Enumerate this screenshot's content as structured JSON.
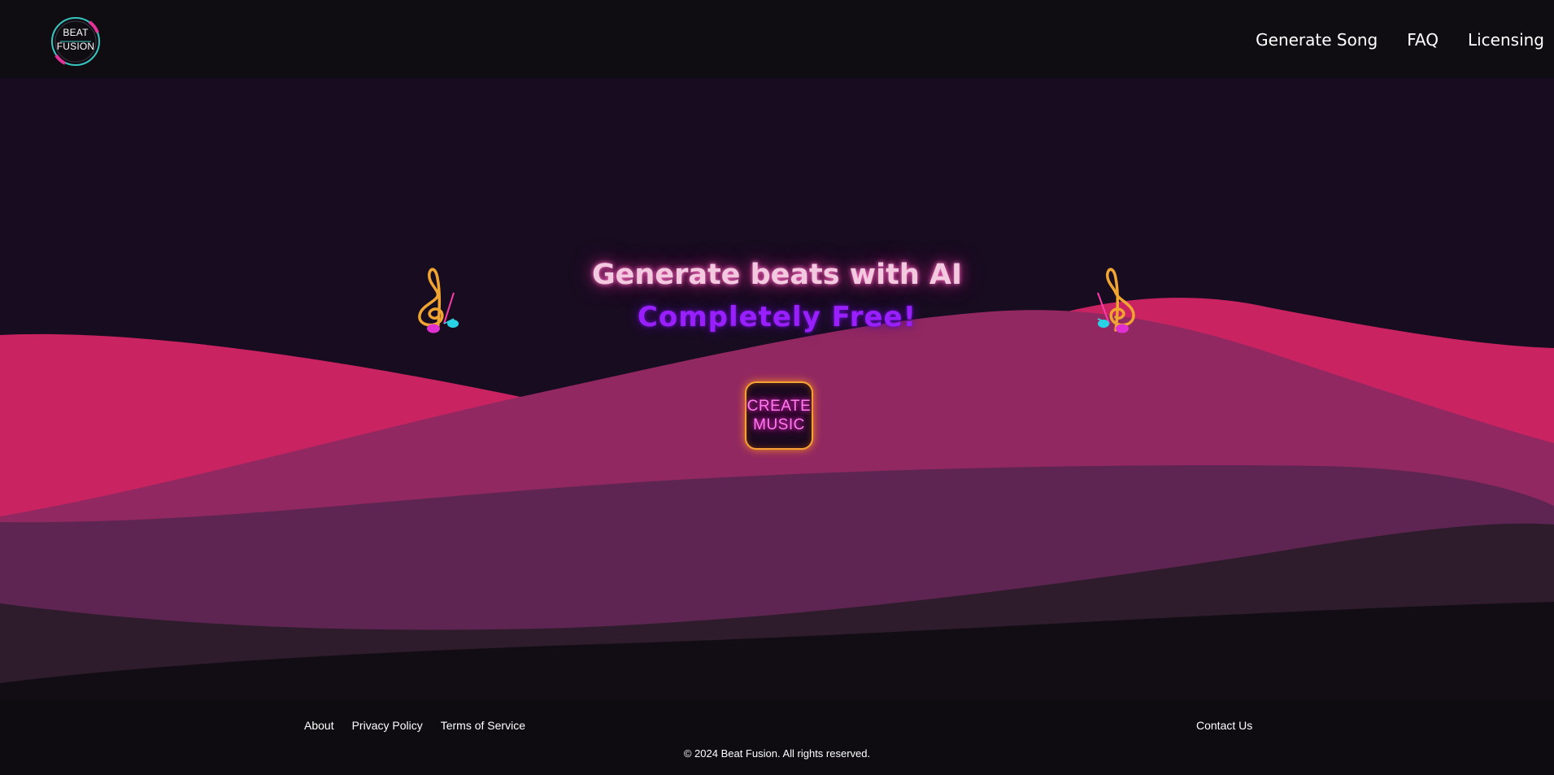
{
  "header": {
    "logo_line1": "BEAT",
    "logo_line2": "FUSION",
    "nav": [
      {
        "label": "Generate Song"
      },
      {
        "label": "FAQ"
      },
      {
        "label": "Licensing"
      }
    ]
  },
  "hero": {
    "title": "Generate beats with AI",
    "subtitle": "Completely  Free!",
    "cta_line1": "CREATE",
    "cta_line2": "MUSIC"
  },
  "footer": {
    "links": [
      {
        "label": "About"
      },
      {
        "label": "Privacy Policy"
      },
      {
        "label": "Terms of Service"
      }
    ],
    "contact": "Contact Us",
    "copyright": "© 2024 Beat Fusion. All rights reserved."
  },
  "icons": {
    "logo": "beat-fusion-logo-icon",
    "left_clef": "treble-clef-icon",
    "right_clef": "treble-clef-icon"
  },
  "colors": {
    "header_bg": "#0f0c12",
    "hero_bg": "#180c21",
    "wave_pink": "#c92461",
    "wave_magenta": "#922861",
    "wave_plum": "#5f2552",
    "wave_dark": "#2e1c2d",
    "footer_bg": "#0e0c10",
    "cta_border": "#f6a234",
    "cta_text": "#ff7bf0",
    "subtitle": "#9a1fff"
  }
}
